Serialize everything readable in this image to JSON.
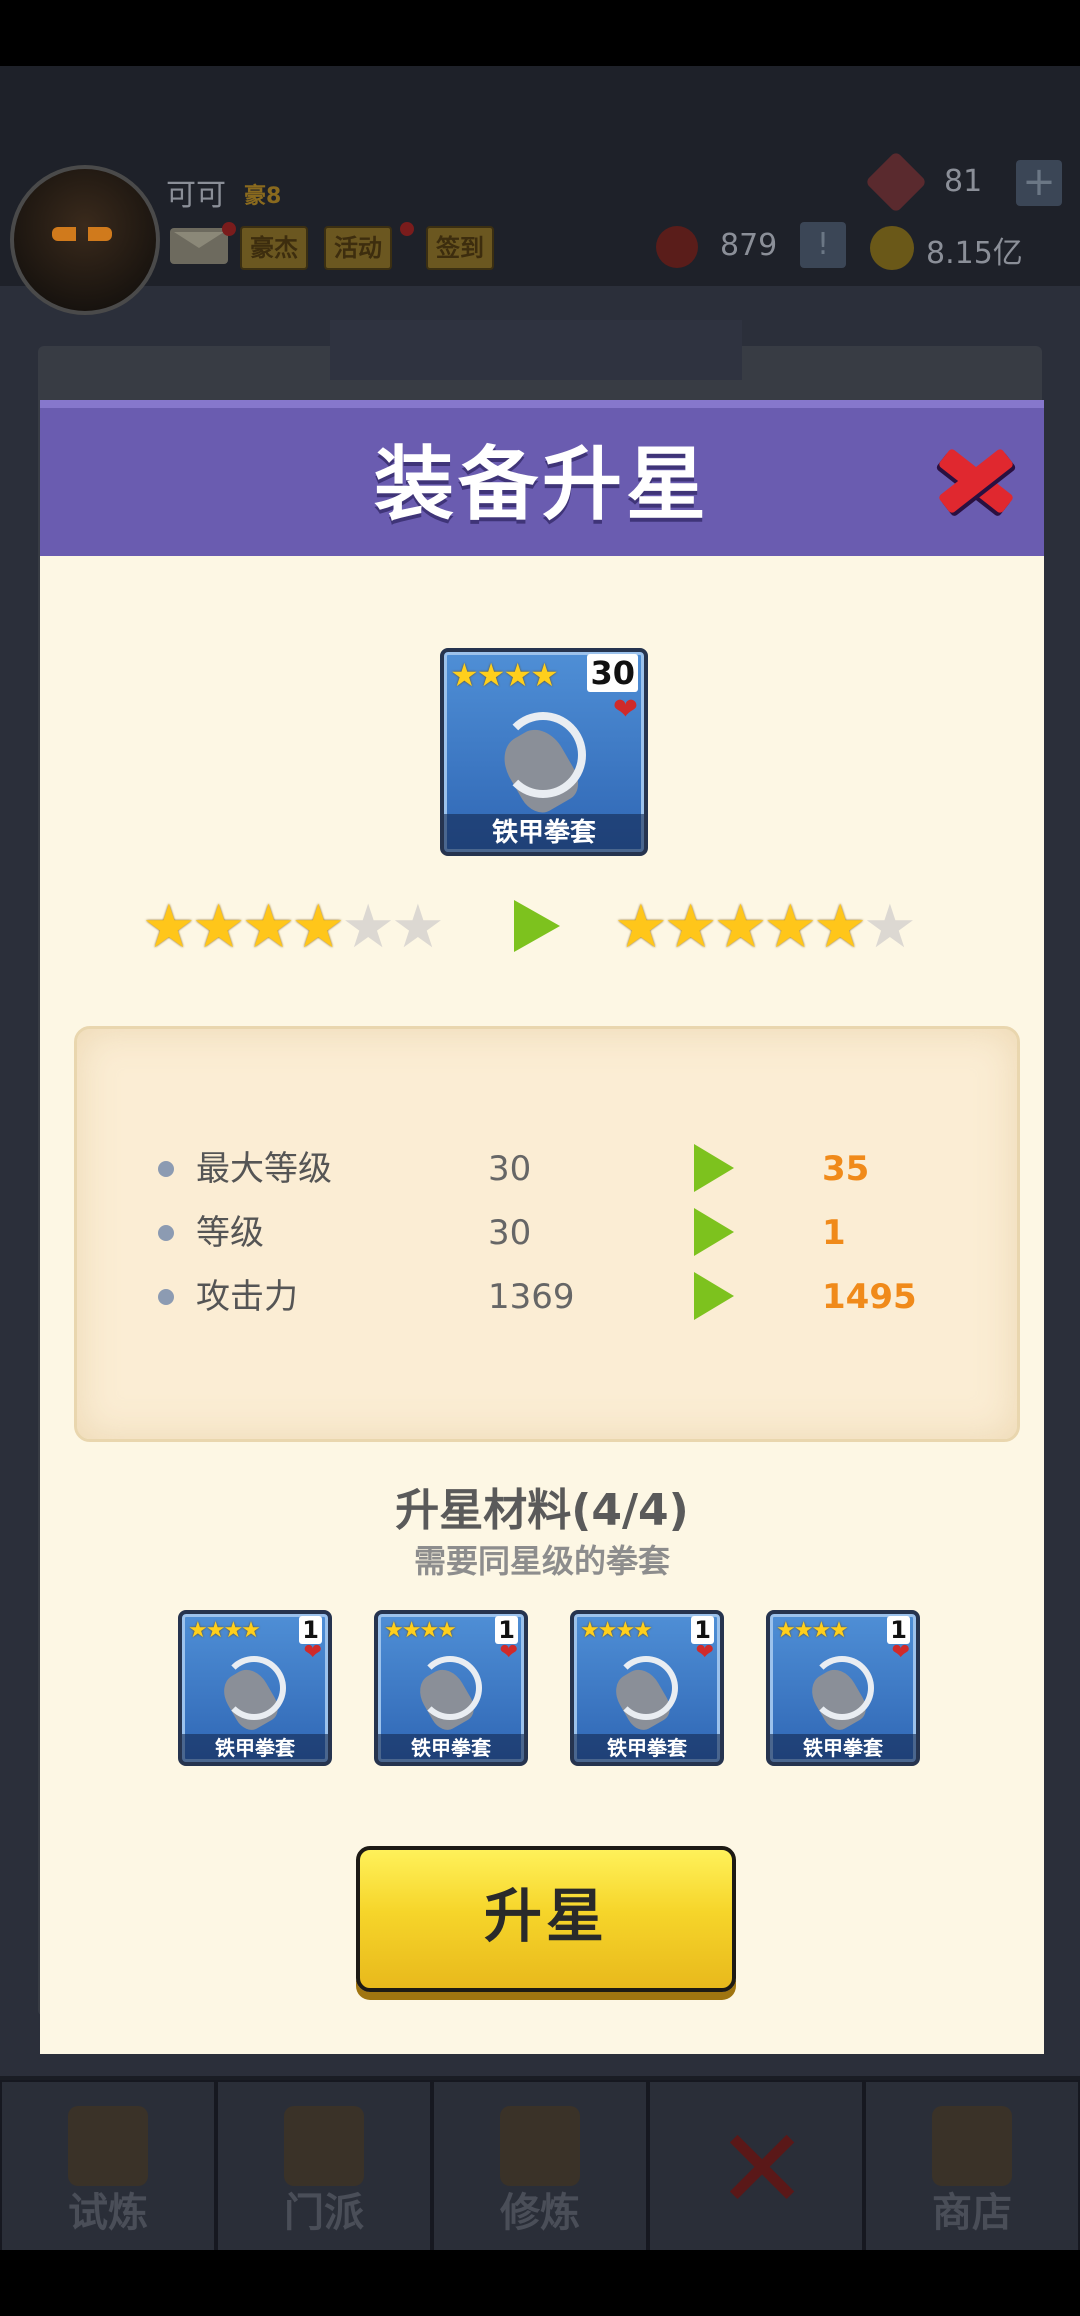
{
  "player": {
    "name": "可可",
    "rank": "豪8"
  },
  "top_buttons": {
    "hero": "豪杰",
    "event": "活动",
    "checkin": "签到"
  },
  "resources": {
    "gems": "81",
    "tokens": "879",
    "coins": "8.15亿"
  },
  "icons": {
    "plus": "+",
    "warn": "!"
  },
  "modal": {
    "title": "装备升星",
    "close_icon": "close-x-icon",
    "item": {
      "name": "铁甲拳套",
      "stars": "★★★★",
      "level": "30",
      "heart": "❤"
    },
    "star_change": {
      "from": 4,
      "to": 5,
      "max": 6
    },
    "stats": [
      {
        "label": "最大等级",
        "old": "30",
        "new": "35"
      },
      {
        "label": "等级",
        "old": "30",
        "new": "1"
      },
      {
        "label": "攻击力",
        "old": "1369",
        "new": "1495"
      }
    ],
    "materials_title": "升星材料(4/4)",
    "materials_sub": "需要同星级的拳套",
    "materials": [
      {
        "name": "铁甲拳套",
        "stars": "★★★★",
        "count": "1",
        "heart": "❤"
      },
      {
        "name": "铁甲拳套",
        "stars": "★★★★",
        "count": "1",
        "heart": "❤"
      },
      {
        "name": "铁甲拳套",
        "stars": "★★★★",
        "count": "1",
        "heart": "❤"
      },
      {
        "name": "铁甲拳套",
        "stars": "★★★★",
        "count": "1",
        "heart": "❤"
      }
    ],
    "upgrade_button": "升星"
  },
  "nav": [
    {
      "label": "试炼"
    },
    {
      "label": "门派"
    },
    {
      "label": "修炼"
    },
    {
      "label": ""
    },
    {
      "label": "商店"
    }
  ],
  "colors": {
    "header": "#6a5cb0",
    "modal_bg": "#fdf7e4",
    "accent_orange": "#f08a1a",
    "button_yellow": "#f6d52a"
  }
}
